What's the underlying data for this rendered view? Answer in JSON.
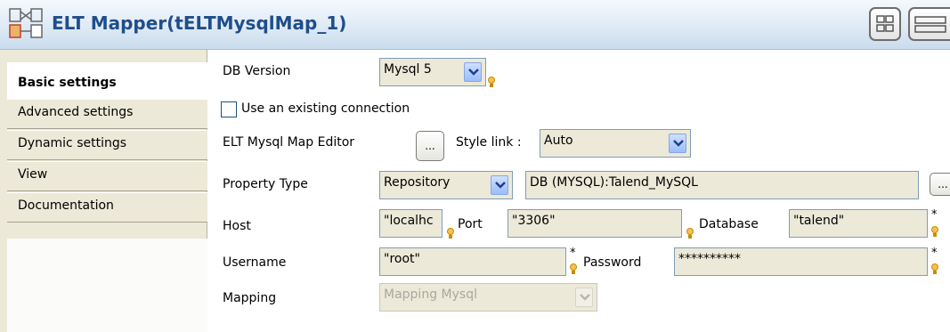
{
  "header": {
    "title": "ELT Mapper(tELTMysqlMap_1)"
  },
  "tabs": [
    {
      "label": "Basic settings"
    },
    {
      "label": "Advanced settings"
    },
    {
      "label": "Dynamic settings"
    },
    {
      "label": "View"
    },
    {
      "label": "Documentation"
    }
  ],
  "form": {
    "db_version": {
      "label": "DB Version",
      "value": "Mysql 5"
    },
    "use_existing": {
      "label": "Use an existing connection",
      "checked": false
    },
    "editor": {
      "label": "ELT Mysql Map Editor",
      "button": "..."
    },
    "style_link": {
      "label": "Style link :",
      "value": "Auto"
    },
    "property_type": {
      "label": "Property Type",
      "value": "Repository",
      "repo_value": "DB (MYSQL):Talend_MySQL",
      "button": "..."
    },
    "host": {
      "label": "Host",
      "value": "\"localhc"
    },
    "port": {
      "label": "Port",
      "value": "\"3306\""
    },
    "database": {
      "label": "Database",
      "value": "\"talend\""
    },
    "username": {
      "label": "Username",
      "value": "\"root\""
    },
    "password": {
      "label": "Password",
      "value": "**********"
    },
    "mapping": {
      "label": "Mapping",
      "value": "Mapping Mysql"
    },
    "required_marker": "*"
  },
  "icons": {
    "header": "elt-mapper-icon",
    "layout1": "layout-grid-icon",
    "layout2": "layout-rows-icon",
    "hint": "lightbulb-icon",
    "dropdown": "chevron-down-icon"
  }
}
